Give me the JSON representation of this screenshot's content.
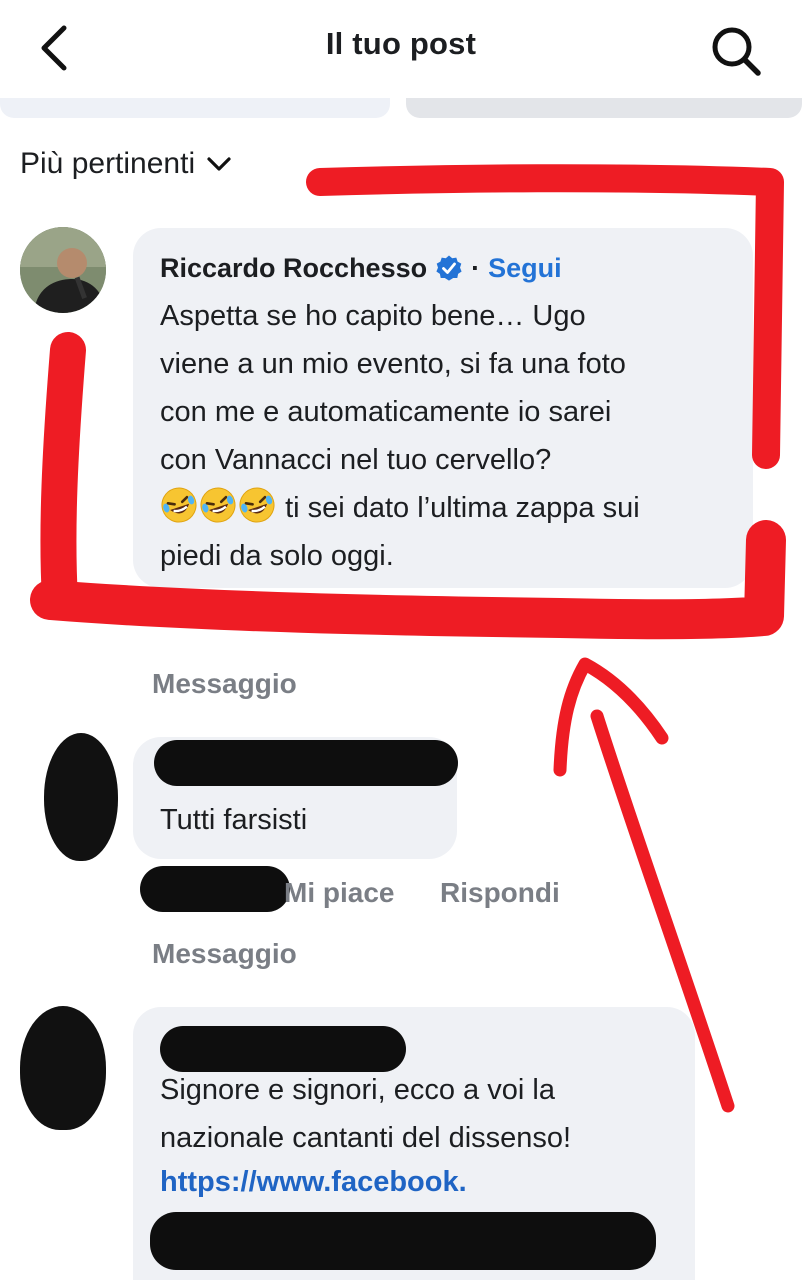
{
  "header": {
    "title": "Il tuo post",
    "back_icon": "chevron-left-icon",
    "search_icon": "search-icon"
  },
  "sort": {
    "label": "Più pertinenti",
    "icon": "chevron-down-icon"
  },
  "comments": [
    {
      "author": "Riccardo Rocchesso",
      "verified": true,
      "separator": "·",
      "follow_label": "Segui",
      "lines": [
        "Aspetta se ho capito bene…  Ugo",
        "viene a un mio evento, si fa una foto",
        "con me e automaticamente io sarei",
        "con Vannacci nel tuo cervello?"
      ],
      "emoji_line_text": "ti sei dato l’ultima zappa sui",
      "last_line": "piedi da solo oggi.",
      "emoji": "rolling-on-floor-laughing",
      "reply_label": "Messaggio"
    },
    {
      "body": "Tutti farsisti",
      "like_label": "Mi piace",
      "reply_label": "Rispondi",
      "message_label": "Messaggio"
    },
    {
      "lines": [
        "Signore e signori, ecco a voi la",
        "nazionale cantanti del dissenso!"
      ],
      "link": "https://www.facebook."
    }
  ],
  "colors": {
    "bubble": "#eff1f5",
    "link": "#1f64c4",
    "verified": "#2373d6",
    "annotation": "#ee1c24",
    "meta": "#7a7e85"
  }
}
